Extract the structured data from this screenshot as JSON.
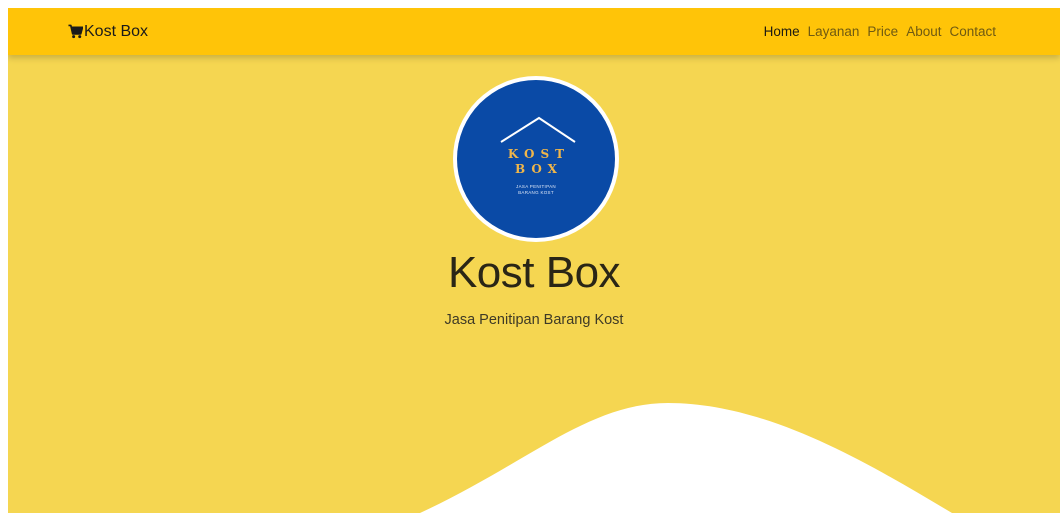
{
  "navbar": {
    "brand_icon": "cart-icon",
    "brand_label": "Kost Box",
    "links": [
      {
        "label": "Home",
        "active": true
      },
      {
        "label": "Layanan",
        "active": false
      },
      {
        "label": "Price",
        "active": false
      },
      {
        "label": "About",
        "active": false
      },
      {
        "label": "Contact",
        "active": false
      }
    ]
  },
  "hero": {
    "logo": {
      "line1": "KOST",
      "line2": "BOX",
      "tagline_1": "JASA PENITIPAN",
      "tagline_2": "BARANG KOST"
    },
    "title": "Kost Box",
    "subtitle": "Jasa Penitipan Barang Kost"
  },
  "colors": {
    "navbar_bg": "#ffc408",
    "hero_bg": "#f5d651",
    "logo_bg": "#0a4aa6",
    "logo_text": "#f0b64a",
    "wave": "#ffffff"
  }
}
